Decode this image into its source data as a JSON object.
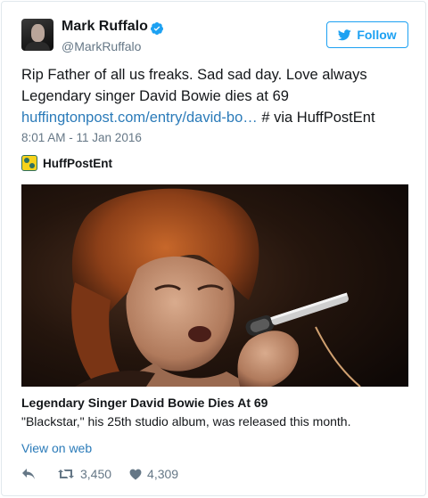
{
  "author": {
    "name": "Mark Ruffalo",
    "handle": "@MarkRuffalo",
    "verified": true
  },
  "follow_button": {
    "label": "Follow",
    "icon": "twitter-bird-icon"
  },
  "tweet": {
    "text_line1": "Rip Father of all us freaks. Sad sad day. Love always",
    "text_line2": "Legendary singer David Bowie dies at 69",
    "link_text": "huffingtonpost.com/entry/david-bo…",
    "text_suffix": " # via HuffPostEnt",
    "timestamp": "8:01 AM - 11 Jan 2016"
  },
  "card": {
    "source_name": "HuffPostEnt",
    "title": "Legendary Singer David Bowie Dies At 69",
    "description": "\"Blackstar,\" his 25th studio album, was released this month.",
    "view_on_web": "View on web"
  },
  "actions": {
    "reply_icon": "reply-icon",
    "retweet_count": "3,450",
    "like_count": "4,309"
  },
  "colors": {
    "accent": "#1da1f2",
    "link": "#2b7bb9",
    "muted": "#657786",
    "text": "#14171a"
  }
}
